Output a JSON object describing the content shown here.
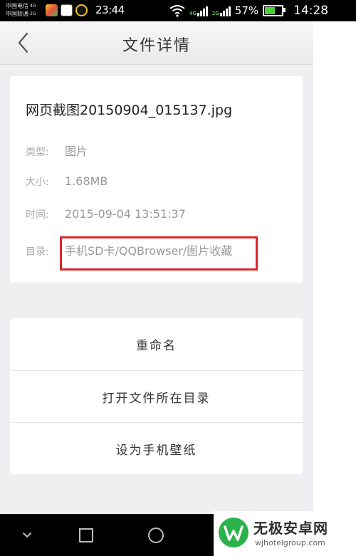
{
  "status_bar": {
    "carrier_line1": "中国电信",
    "carrier_net1": "4G",
    "carrier_line2": "中国联通",
    "carrier_net2": "2G",
    "notification_time": "23:44",
    "signal_label1": "4G",
    "signal_label2": "2G",
    "battery_percent": "57%",
    "clock": "14:28",
    "battery_level": 0.57
  },
  "header": {
    "title": "文件详情"
  },
  "file_info": {
    "file_name": "网页截图20150904_015137.jpg",
    "type_label": "类型:",
    "type_value": "图片",
    "size_label": "大小:",
    "size_value": "1.68MB",
    "time_label": "时间:",
    "time_value": "2015-09-04 13:51:37",
    "dir_label": "目录:",
    "dir_value": "手机SD卡/QQBrowser/图片收藏"
  },
  "actions": {
    "rename": "重命名",
    "open_folder": "打开文件所在目录",
    "set_wallpaper": "设为手机壁纸"
  },
  "watermark": {
    "brand": "无极安卓网",
    "url": "wjhotelgroup.com"
  },
  "colors": {
    "highlight": "#d9262c",
    "background": "#efeff1",
    "card": "#ffffff"
  }
}
